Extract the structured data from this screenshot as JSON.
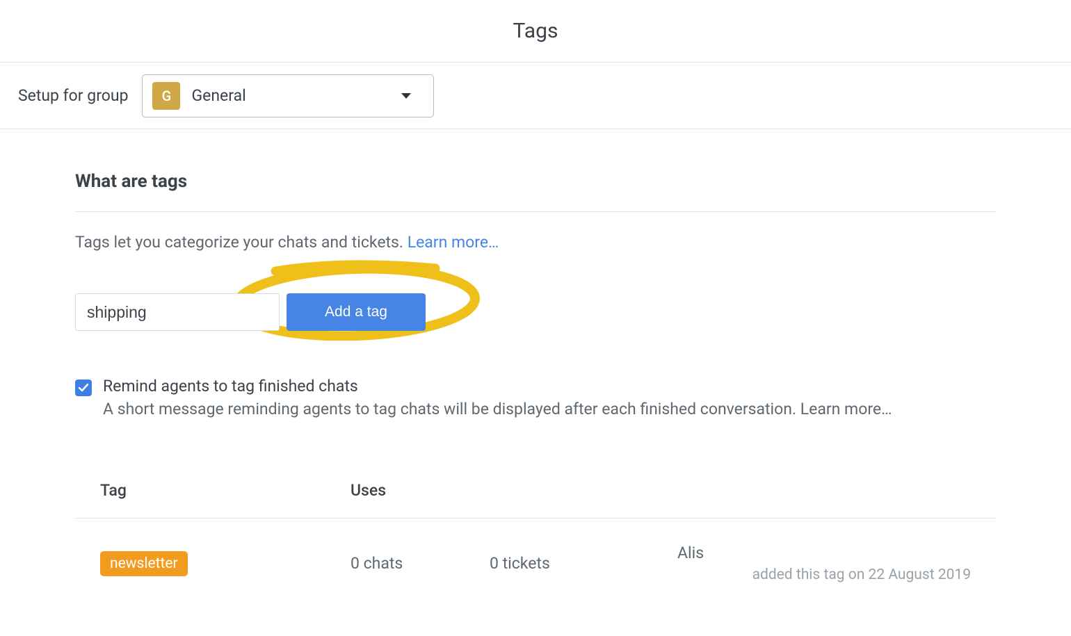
{
  "header": {
    "title": "Tags"
  },
  "group_selector": {
    "label": "Setup for group",
    "badge_letter": "G",
    "selected": "General"
  },
  "section": {
    "title": "What are tags",
    "description": "Tags let you categorize your chats and tickets. ",
    "learn_more": "Learn more…"
  },
  "add_tag": {
    "input_value": "shipping",
    "button_label": "Add a tag"
  },
  "remind": {
    "checked": true,
    "label": "Remind agents to tag finished chats",
    "description": "A short message reminding agents to tag chats will be displayed after each finished conversation. Learn more…"
  },
  "table": {
    "headers": {
      "tag": "Tag",
      "uses": "Uses"
    },
    "rows": [
      {
        "tag": "newsletter",
        "chats": "0 chats",
        "tickets": "0 tickets",
        "author": "Alis",
        "author_meta": "added this tag on 22 August 2019"
      }
    ]
  },
  "colors": {
    "accent_blue": "#4684e6",
    "highlight_yellow": "#eec019",
    "tag_orange": "#f39b1e",
    "badge_gold": "#d0a846"
  }
}
